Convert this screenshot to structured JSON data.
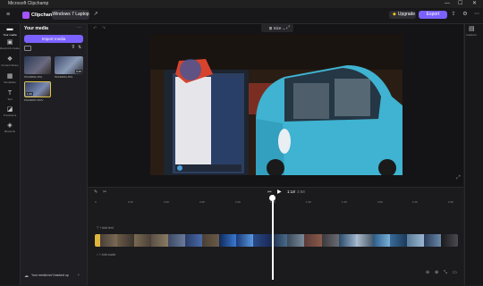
{
  "window": {
    "title": "Microsoft Clipchamp",
    "minimize": "—",
    "maximize": "☐",
    "close": "✕"
  },
  "header": {
    "brand": "Clipchamp",
    "project_tab": "Windows 7 Laptop",
    "upgrade_label": "Upgrade",
    "export_label": "Export"
  },
  "rail": {
    "items": [
      {
        "label": "Your media",
        "icon": "folder-icon"
      },
      {
        "label": "Record & create",
        "icon": "camera-icon"
      },
      {
        "label": "Content library",
        "icon": "library-icon"
      },
      {
        "label": "Templates",
        "icon": "templates-icon"
      },
      {
        "label": "Text",
        "icon": "text-icon"
      },
      {
        "label": "Transitions",
        "icon": "transitions-icon"
      },
      {
        "label": "Brand kit",
        "icon": "brand-icon"
      }
    ]
  },
  "media": {
    "title": "Your media",
    "import_label": "Import media",
    "items": [
      {
        "name": "P1040093.JPG",
        "duration": ""
      },
      {
        "name": "P1040094.JPG",
        "duration": "0:45"
      },
      {
        "name": "P1040097.MOV",
        "duration": "1:43"
      }
    ],
    "backup_notice": "Your media isn't backed up"
  },
  "preview": {
    "size_label": "Size"
  },
  "playback": {
    "current_time": "1:14",
    "total_time": "3:58"
  },
  "timeline": {
    "ticks": [
      "0",
      "0:15",
      "0:30",
      "0:45",
      "1:00",
      "1:15",
      "1:30",
      "1:45",
      "2:00",
      "2:15",
      "2:30",
      "2:45"
    ],
    "add_text_label": "+ Add text",
    "add_audio_label": "+ Add audio"
  },
  "rightpanel": {
    "label": "Captions"
  },
  "colors": {
    "accent": "#7b61ff",
    "car": "#3fb3d1"
  }
}
